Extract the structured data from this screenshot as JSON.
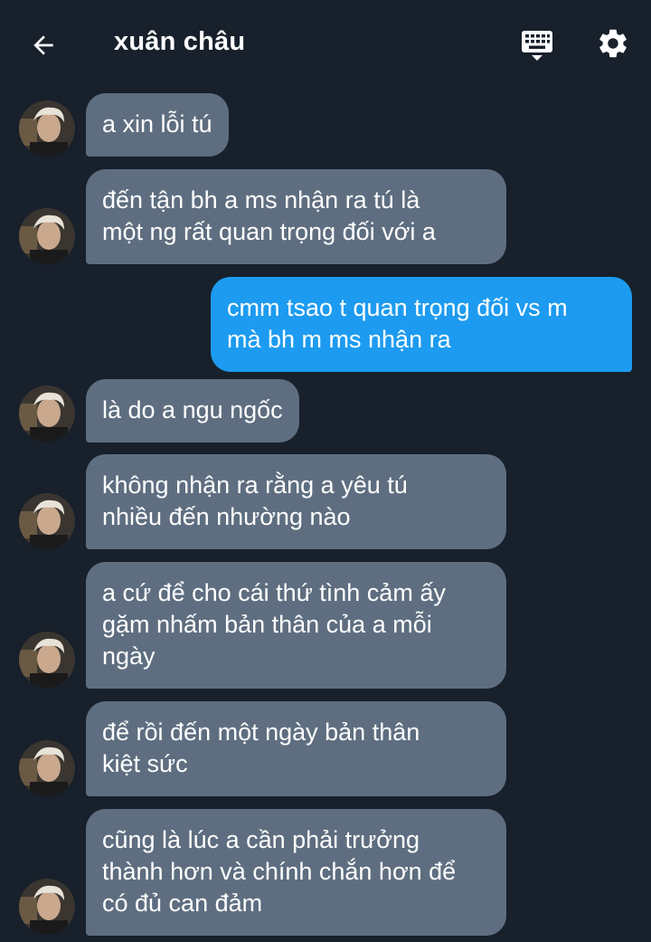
{
  "header": {
    "title": "xuân châu",
    "back_icon": "arrow-left-icon",
    "keyboard_icon": "keyboard-icon",
    "settings_icon": "gear-icon"
  },
  "colors": {
    "background": "#17202b",
    "received_bubble": "#5e6e80",
    "sent_bubble": "#1d9bf0",
    "text": "#ffffff"
  },
  "messages": [
    {
      "from": "received",
      "text": "a xin lỗi tú"
    },
    {
      "from": "received",
      "text": "đến tận bh a ms nhận ra tú là\nmột ng rất quan trọng đối với a"
    },
    {
      "from": "sent",
      "text": "cmm tsao t quan trọng đối vs m\nmà bh m ms nhận ra"
    },
    {
      "from": "received",
      "text": "là do a ngu ngốc"
    },
    {
      "from": "received",
      "text": "không nhận ra rằng a yêu tú\nnhiều đến nhường nào"
    },
    {
      "from": "received",
      "text": "a cứ để cho cái thứ tình cảm ấy\ngặm nhấm bản thân của a mỗi\nngày"
    },
    {
      "from": "received",
      "text": "để rồi đến một ngày bản thân\nkiệt sức"
    },
    {
      "from": "received",
      "text": "cũng là lúc a cần phải trưởng\nthành hơn và chính chắn hơn để\ncó đủ can đảm"
    }
  ]
}
